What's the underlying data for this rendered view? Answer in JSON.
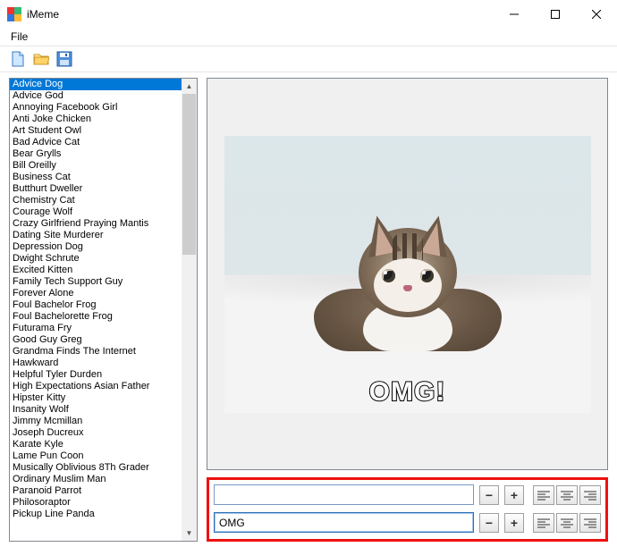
{
  "window": {
    "title": "iMeme"
  },
  "menu": {
    "file": "File"
  },
  "templates": {
    "selected_index": 0,
    "items": [
      "Advice Dog",
      "Advice God",
      "Annoying Facebook Girl",
      "Anti Joke Chicken",
      "Art Student Owl",
      "Bad Advice Cat",
      "Bear Grylls",
      "Bill Oreilly",
      "Business Cat",
      "Butthurt Dweller",
      "Chemistry Cat",
      "Courage Wolf",
      "Crazy Girlfriend Praying Mantis",
      "Dating Site Murderer",
      "Depression Dog",
      "Dwight Schrute",
      "Excited Kitten",
      "Family Tech Support Guy",
      "Forever Alone",
      "Foul Bachelor Frog",
      "Foul Bachelorette Frog",
      "Futurama Fry",
      "Good Guy Greg",
      "Grandma Finds The Internet",
      "Hawkward",
      "Helpful Tyler Durden",
      "High Expectations Asian Father",
      "Hipster Kitty",
      "Insanity Wolf",
      "Jimmy Mcmillan",
      "Joseph Ducreux",
      "Karate Kyle",
      "Lame Pun Coon",
      "Musically Oblivious 8Th Grader",
      "Ordinary Muslim Man",
      "Paranoid Parrot",
      "Philosoraptor",
      "Pickup Line Panda"
    ]
  },
  "caption": {
    "top": "",
    "bottom": "OMG!",
    "bottom_input": "OMG"
  },
  "buttons": {
    "minus": "−",
    "plus": "+"
  }
}
